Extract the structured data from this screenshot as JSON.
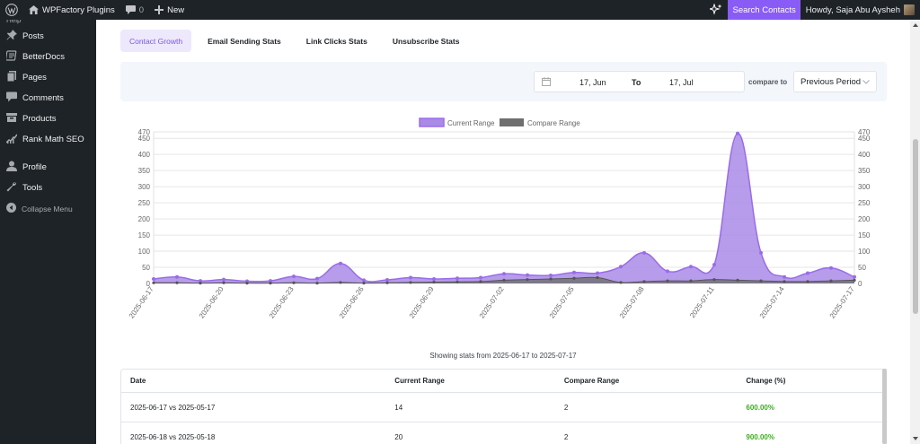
{
  "adminbar": {
    "site_name": "WPFactory Plugins",
    "comments_count": "0",
    "new_label": "New",
    "search_contacts_label": "Search Contacts",
    "howdy": "Howdy, Saja Abu Aysheh"
  },
  "sidebar": {
    "help_fragment": "Help",
    "items": [
      {
        "label": "Posts",
        "icon": "pushpin-icon"
      },
      {
        "label": "BetterDocs",
        "icon": "docs-icon"
      },
      {
        "label": "Pages",
        "icon": "pages-icon"
      },
      {
        "label": "Comments",
        "icon": "comment-icon"
      },
      {
        "label": "Products",
        "icon": "archive-icon"
      },
      {
        "label": "Rank Math SEO",
        "icon": "chart-icon"
      },
      {
        "label": "Profile",
        "icon": "user-icon"
      },
      {
        "label": "Tools",
        "icon": "wrench-icon"
      }
    ],
    "collapse_label": "Collapse Menu"
  },
  "tabs": [
    {
      "label": "Contact Growth",
      "active": true
    },
    {
      "label": "Email Sending Stats",
      "active": false
    },
    {
      "label": "Link Clicks Stats",
      "active": false
    },
    {
      "label": "Unsubscribe Stats",
      "active": false
    }
  ],
  "filter": {
    "from_date": "17, Jun",
    "to_label": "To",
    "to_date": "17, Jul",
    "compare_label": "compare to",
    "compare_value": "Previous Period"
  },
  "colors": {
    "current_fill": "#a98be6",
    "current_line": "#9a6ce8",
    "compare_fill": "#6f6f6f",
    "accent": "#8a5cf6",
    "change_positive": "#3dae1f"
  },
  "chart_data": {
    "type": "area",
    "legend": [
      "Current Range",
      "Compare Range"
    ],
    "legend_position": "top",
    "ylim": [
      0,
      470
    ],
    "yticks": [
      0,
      50,
      100,
      150,
      200,
      250,
      300,
      350,
      400,
      450,
      470
    ],
    "grid": true,
    "x": [
      "2025-06-17",
      "2025-06-18",
      "2025-06-19",
      "2025-06-20",
      "2025-06-21",
      "2025-06-22",
      "2025-06-23",
      "2025-06-24",
      "2025-06-25",
      "2025-06-26",
      "2025-06-27",
      "2025-06-28",
      "2025-06-29",
      "2025-06-30",
      "2025-07-01",
      "2025-07-02",
      "2025-07-03",
      "2025-07-04",
      "2025-07-05",
      "2025-07-06",
      "2025-07-07",
      "2025-07-08",
      "2025-07-09",
      "2025-07-10",
      "2025-07-11",
      "2025-07-12",
      "2025-07-13",
      "2025-07-14",
      "2025-07-15",
      "2025-07-16",
      "2025-07-17"
    ],
    "xtick_labels": [
      "2025-06-17",
      "2025-06-20",
      "2025-06-23",
      "2025-06-26",
      "2025-06-29",
      "2025-07-02",
      "2025-07-05",
      "2025-07-08",
      "2025-07-11",
      "2025-07-14",
      "2025-07-17"
    ],
    "series": [
      {
        "name": "Current Range",
        "values": [
          14,
          20,
          8,
          12,
          7,
          8,
          22,
          15,
          62,
          10,
          11,
          18,
          14,
          16,
          18,
          30,
          26,
          25,
          34,
          32,
          52,
          95,
          38,
          52,
          58,
          465,
          95,
          20,
          32,
          48,
          20
        ]
      },
      {
        "name": "Compare Range",
        "values": [
          2,
          2,
          1,
          2,
          1,
          1,
          2,
          1,
          3,
          1,
          2,
          3,
          4,
          5,
          6,
          10,
          12,
          14,
          16,
          18,
          3,
          6,
          8,
          8,
          12,
          10,
          8,
          6,
          6,
          8,
          10
        ]
      }
    ]
  },
  "stats_range_text": "Showing stats from 2025-06-17 to 2025-07-17",
  "table": {
    "headers": [
      "Date",
      "Current Range",
      "Compare Range",
      "Change (%)"
    ],
    "rows": [
      {
        "date": "2025-06-17 vs 2025-05-17",
        "current": "14",
        "compare": "2",
        "change": "600.00%"
      },
      {
        "date": "2025-06-18 vs 2025-05-18",
        "current": "20",
        "compare": "2",
        "change": "900.00%"
      }
    ]
  }
}
